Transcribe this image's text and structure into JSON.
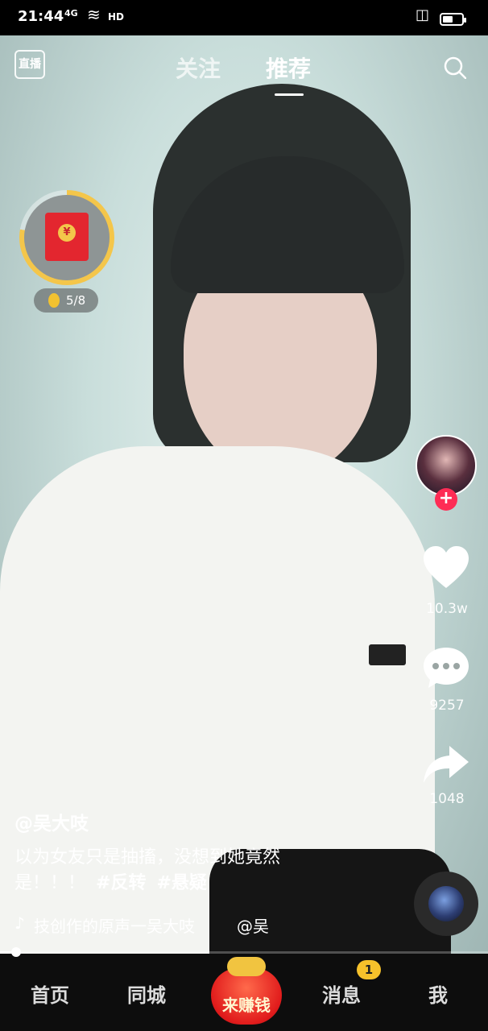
{
  "status": {
    "time": "21:44",
    "network": "4G",
    "hd": "HD",
    "battery_level": 0.55
  },
  "top_nav": {
    "live_label": "直播",
    "tabs": [
      {
        "label": "关注",
        "active": false
      },
      {
        "label": "推荐",
        "active": true
      }
    ]
  },
  "reward": {
    "progress": "5/8",
    "envelope_symbol": "¥"
  },
  "actions": {
    "likes": "10.3w",
    "comments": "9257",
    "shares": "1048",
    "follow_symbol": "+"
  },
  "video": {
    "author": "@吴大吱",
    "description": "以为女友只是抽搐，没想到她竟然是！！！",
    "hashtags": [
      "#反转",
      "#悬疑"
    ],
    "music": "技创作的原声一吴大吱",
    "music_mention": "@吴"
  },
  "playback": {
    "progress_fraction": 0.03
  },
  "bottom_nav": {
    "home": "首页",
    "city": "同城",
    "earn": "来赚钱",
    "messages": "消息",
    "messages_badge": "1",
    "me": "我"
  },
  "colors": {
    "accent_red": "#fe2c55",
    "badge_yellow": "#f6c12b"
  }
}
